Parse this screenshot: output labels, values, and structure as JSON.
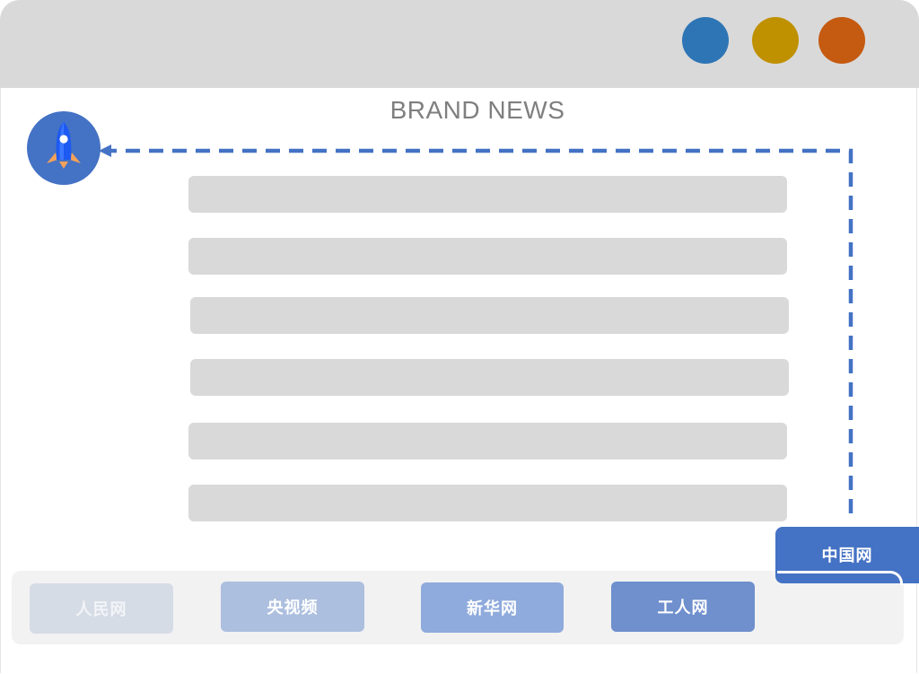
{
  "window": {
    "controls": [
      {
        "name": "window-control-blue",
        "color": "#2e75b6"
      },
      {
        "name": "window-control-gold",
        "color": "#bf9000"
      },
      {
        "name": "window-control-orange",
        "color": "#c55a11"
      }
    ]
  },
  "header": {
    "title": "BRAND NEWS"
  },
  "launcher": {
    "icon": "rocket-icon",
    "accent": "#4472c4"
  },
  "news_list": {
    "rows": [
      {
        "text": ""
      },
      {
        "text": ""
      },
      {
        "text": ""
      },
      {
        "text": ""
      },
      {
        "text": ""
      },
      {
        "text": ""
      }
    ]
  },
  "sources": {
    "tabs": [
      {
        "label": "人民网",
        "color": "#d6dce5"
      },
      {
        "label": "央视频",
        "color": "#adbfdf"
      },
      {
        "label": "新华网",
        "color": "#8faadc"
      },
      {
        "label": "工人网",
        "color": "#6f8fcd"
      }
    ],
    "active": {
      "label": "中国网",
      "color": "#4472c4"
    }
  }
}
